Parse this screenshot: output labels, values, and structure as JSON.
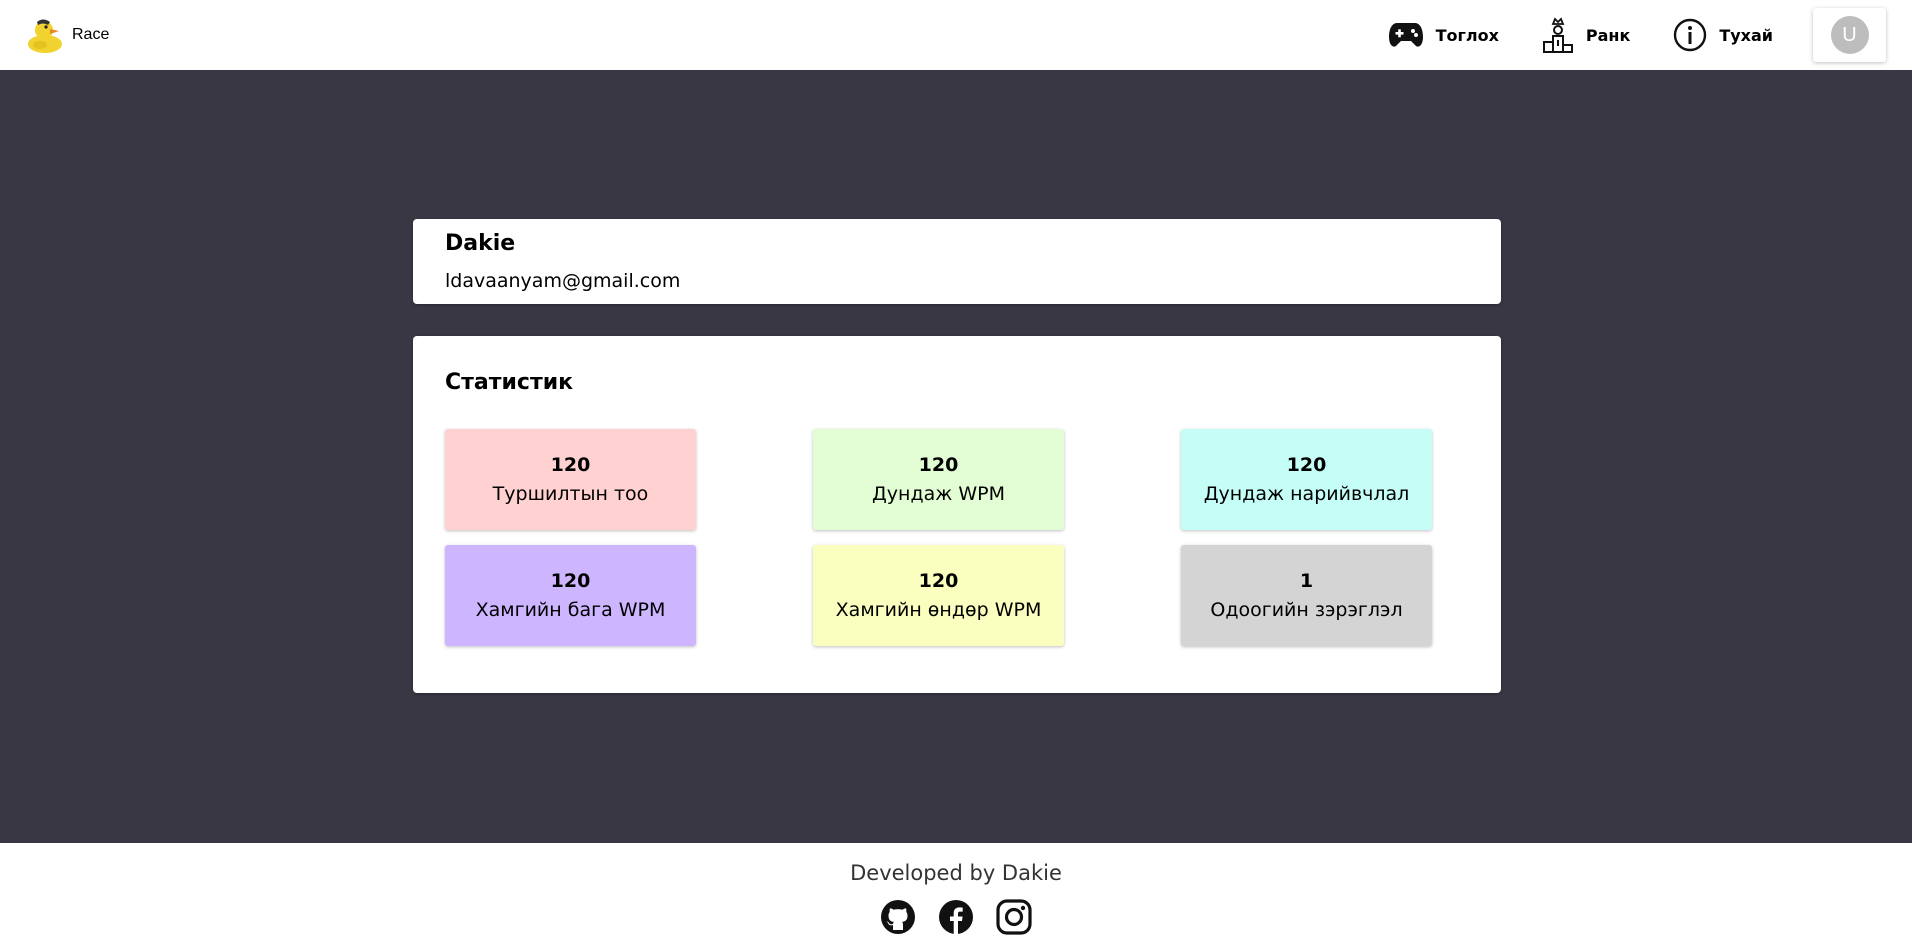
{
  "header": {
    "brand": "Race",
    "nav": [
      {
        "label": "Тоглох",
        "icon": "gamepad-icon"
      },
      {
        "label": "Ранк",
        "icon": "podium-icon"
      },
      {
        "label": "Тухай",
        "icon": "info-icon"
      }
    ],
    "avatar_initial": "U"
  },
  "profile": {
    "name": "Dakie",
    "email": "ldavaanyam@gmail.com"
  },
  "stats": {
    "title": "Статистик",
    "items": [
      {
        "value": "120",
        "label": "Туршилтын тоо",
        "color": "#ffd1d1"
      },
      {
        "value": "120",
        "label": "Дундаж WPM",
        "color": "#e2fdd4"
      },
      {
        "value": "120",
        "label": "Дундаж нарийвчлал",
        "color": "#c5fef7"
      },
      {
        "value": "120",
        "label": "Хамгийн бага WPM",
        "color": "#cdb6ff"
      },
      {
        "value": "120",
        "label": "Хамгийн өндөр WPM",
        "color": "#fafebe"
      },
      {
        "value": "1",
        "label": "Одоогийн зэрэглэл",
        "color": "#d4d4d4"
      }
    ]
  },
  "footer": {
    "text": "Developed by Dakie",
    "socials": [
      "github-icon",
      "facebook-icon",
      "instagram-icon"
    ]
  },
  "colors": {
    "background": "#3a3745",
    "surface": "#ffffff"
  }
}
